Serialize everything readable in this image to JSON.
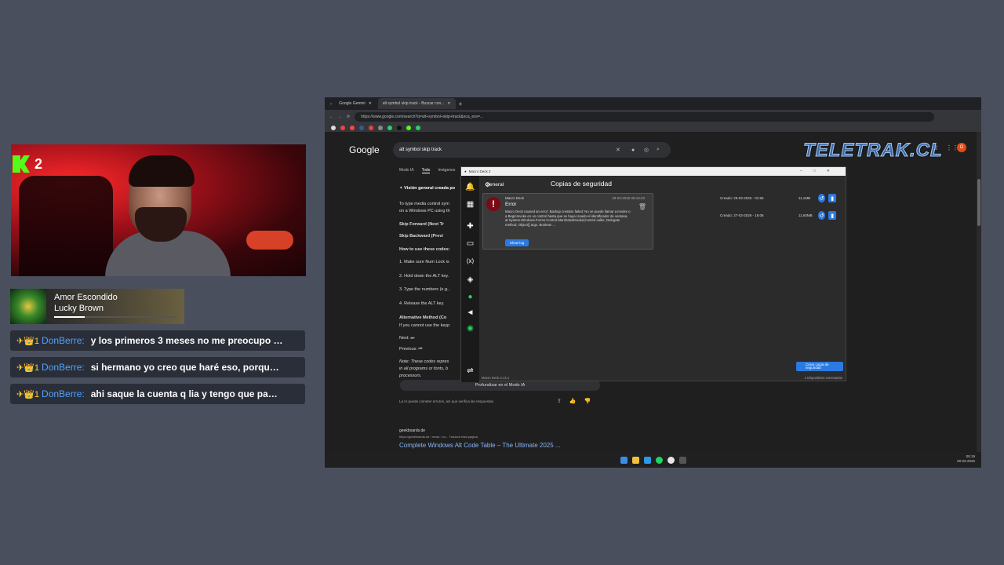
{
  "webcam": {
    "kick_count": "2"
  },
  "now_playing": {
    "title": "Amor Escondido",
    "artist": "Lucky Brown",
    "progress_percent": 25
  },
  "chat": [
    {
      "badges": "✈👑1",
      "user": "DonBerre:",
      "message": "y los primeros 3 meses no me preocupo d..."
    },
    {
      "badges": "✈👑1",
      "user": "DonBerre:",
      "message": "si hermano yo creo que haré eso, porque ..."
    },
    {
      "badges": "✈👑1",
      "user": "DonBerre:",
      "message": "ahi saque la cuenta q lia y tengo que paga..."
    }
  ],
  "browser": {
    "tabs": [
      "Google Gemini",
      "alt symbol skip track - Buscar con..."
    ],
    "url": "https://www.google.com/search?q=alt+symbol+skip+track&sca_esv=...",
    "search_query": "alt symbol skip track",
    "google_tabs": [
      "Modo IA",
      "Todo",
      "Imágenes"
    ],
    "overview_title": "Visión general creada po",
    "lines": [
      "To type media control sym",
      "on a Windows PC using th",
      "Skip Forward (Next Tr",
      "Skip Backward (Previ",
      "How to use these codes:",
      "1. Make sure Num Lock is",
      "2. Hold down the ALT key.",
      "3. Type the numbers (e.g.,",
      "4. Release the ALT key.",
      "Alternative Method (Co",
      "If you cannot use the keyp",
      "Next: ⏭",
      "Previous: ⏮",
      "Note: These codes repres",
      "in all programs or fonts, b",
      "processors."
    ],
    "ai_mode_button": "Profundizar en el Modo IA",
    "disclaimer": "La IA puede cometer errores, así que verifica las respuestas",
    "result_site": "geekboards.de",
    "result_url": "https://geekboards.de › news › co...   Traducir esta página",
    "result_title": "Complete Windows Alt Code Table – The Ultimate 2025 ...",
    "clock_time": "05:19",
    "clock_date": "29-03-2026"
  },
  "macro_deck": {
    "window_title": "Macro Deck 2",
    "nav_general": "General",
    "heading": "Copias de seguridad",
    "backups": [
      {
        "created": "Creado: 29-03-2026 - 01:55",
        "size": "11,1MB"
      },
      {
        "created": "Creado: 27-03-2026 - 16:06",
        "size": "11,60MB"
      }
    ],
    "error": {
      "source": "Macro Deck",
      "time": "29-03-2026 05:19:20",
      "title": "Error",
      "body": "Macro Deck caused an error: Backup creation failed: No se puede llamar a Invoke o a BeginInvoke en un control hasta que se haya creado el identificador de ventana. at System.Windows.Forms.Control.MarshaledInvoke(Control caller, Delegate method, Object[] args, Boolean ...",
      "button": "Show log"
    },
    "create_button": "Crear copia de seguridad",
    "version": "Macro Deck 2.14.1",
    "connected": "1 Dispositivos conectados"
  },
  "overlay": {
    "brand": "TELETRAK.CL"
  }
}
